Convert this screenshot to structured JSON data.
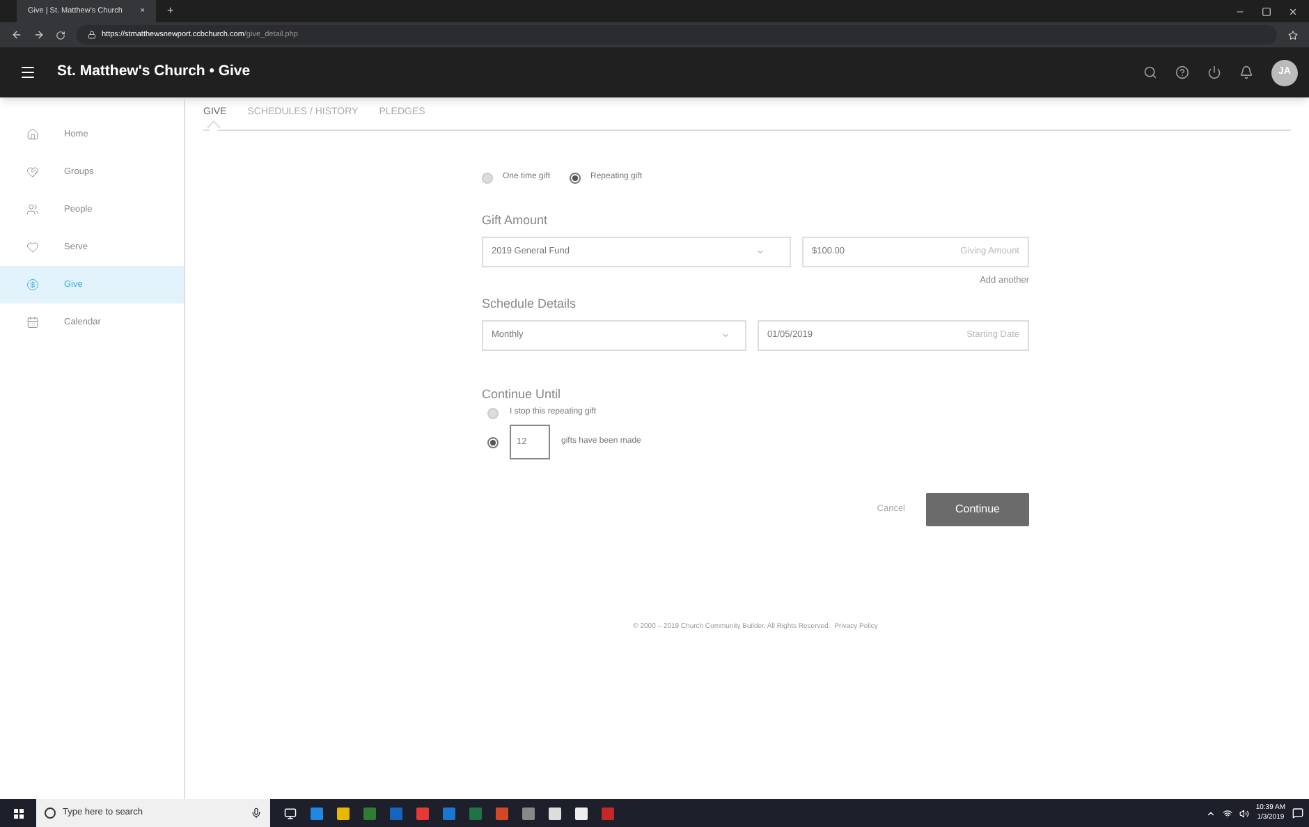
{
  "browser": {
    "tab_title": "Give | St. Matthew's Church",
    "tab_close": "×",
    "new_tab": "+",
    "url_host": "https://stmatthewsnewport.ccbchurch.com",
    "url_path": "/give_detail.php"
  },
  "header": {
    "title": "St. Matthew's Church • Give",
    "avatar": "JA"
  },
  "sidebar": {
    "items": [
      {
        "label": "Home",
        "selected": false
      },
      {
        "label": "Groups",
        "selected": false
      },
      {
        "label": "People",
        "selected": false
      },
      {
        "label": "Serve",
        "selected": false
      },
      {
        "label": "Give",
        "selected": true
      },
      {
        "label": "Calendar",
        "selected": false
      }
    ]
  },
  "tabs": [
    {
      "label": "GIVE",
      "selected": true
    },
    {
      "label": "SCHEDULES / HISTORY",
      "selected": false
    },
    {
      "label": "PLEDGES",
      "selected": false
    }
  ],
  "gift_type": [
    {
      "label": "One time gift",
      "selected": false
    },
    {
      "label": "Repeating gift",
      "selected": true
    }
  ],
  "gift_amount": {
    "heading": "Gift Amount",
    "fund": "2019 General Fund",
    "amount": "$100.00",
    "amount_label": "Giving Amount",
    "add_another": "Add another"
  },
  "schedule": {
    "heading": "Schedule Details",
    "frequency": "Monthly",
    "start_date": "01/05/2019",
    "start_label": "Starting Date"
  },
  "continue_until": {
    "heading": "Continue Until",
    "options": [
      {
        "kind": "plain",
        "label": "I stop this repeating gift",
        "selected": false
      },
      {
        "kind": "count",
        "value": "12",
        "suffix": "gifts have been made",
        "selected": true
      }
    ]
  },
  "actions": {
    "cancel": "Cancel",
    "continue": "Continue"
  },
  "footer": {
    "text": "© 2000 – 2019 Church Community Builder. All Rights Reserved.",
    "link": "Privacy Policy"
  },
  "taskbar": {
    "search_placeholder": "Type here to search",
    "time": "10:39 AM",
    "date": "1/3/2019"
  }
}
